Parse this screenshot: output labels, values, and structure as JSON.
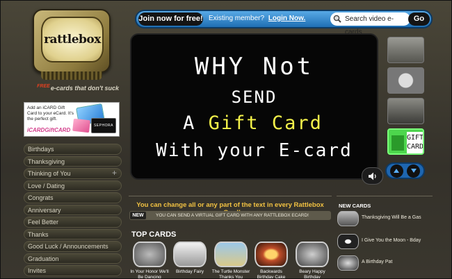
{
  "brand": {
    "logo_text": "rattlebox",
    "tagline_free": "FREE",
    "tagline": "e-cards that don't suck"
  },
  "ad": {
    "text": "Add an iCARD Gift Card to your eCard. It's the perfect gift.",
    "logo": "iCARDGiftCARD",
    "card_brand": "SEPHORA"
  },
  "sidebar": {
    "categories": [
      {
        "label": "Birthdays"
      },
      {
        "label": "Thanksgiving"
      },
      {
        "label": "Thinking of You",
        "expand": "+"
      },
      {
        "label": "Love / Dating"
      },
      {
        "label": "Congrats"
      },
      {
        "label": "Anniversary"
      },
      {
        "label": "Feel Better"
      },
      {
        "label": "Thanks"
      },
      {
        "label": "Good Luck / Announcements"
      },
      {
        "label": "Graduation"
      },
      {
        "label": "Invites"
      }
    ]
  },
  "topbar": {
    "join_label": "Join now for free!",
    "existing_label": "Existing member?",
    "login_label": "Login Now.",
    "search_placeholder": "Search video e-cards",
    "go_label": "Go"
  },
  "video": {
    "line1": "WHY Not",
    "line2": "SEND",
    "line3_prefix": "A",
    "line3_highlight": "Gift Card",
    "line4": "With your E-card",
    "highlight_color": "#f4f24a"
  },
  "thumbs": [
    {
      "name": "thumb-1"
    },
    {
      "name": "thumb-2"
    },
    {
      "name": "thumb-3"
    },
    {
      "name": "thumb-4",
      "label": "GIFT CARD"
    }
  ],
  "info": {
    "headline": "You can change all or any part of the text in every Rattlebox eCard!",
    "badge": "NEW",
    "strip_text": "YOU CAN SEND A VIRTUAL GIFT CARD WITH ANY RATTLEBOX ECARD!"
  },
  "top_cards": {
    "heading": "TOP CARDS",
    "items": [
      {
        "title": "In Your Honor We'll Be Dancing"
      },
      {
        "title": "Birthday Fairy"
      },
      {
        "title": "The Turtle Monster Thanks You"
      },
      {
        "title": "Backwards Birthday Cake"
      },
      {
        "title": "Beary Happy Birthday"
      }
    ]
  },
  "new_cards": {
    "heading": "NEW CARDS",
    "items": [
      {
        "title": "Thanksgiving Will Be a Gas"
      },
      {
        "title": "I Give You the Moon - Bday"
      },
      {
        "title": "A Birthday Pat"
      }
    ]
  },
  "colors": {
    "accent_blue": "#1f6fb4",
    "headline_gold": "#f2c242",
    "background": "#3a372c"
  }
}
